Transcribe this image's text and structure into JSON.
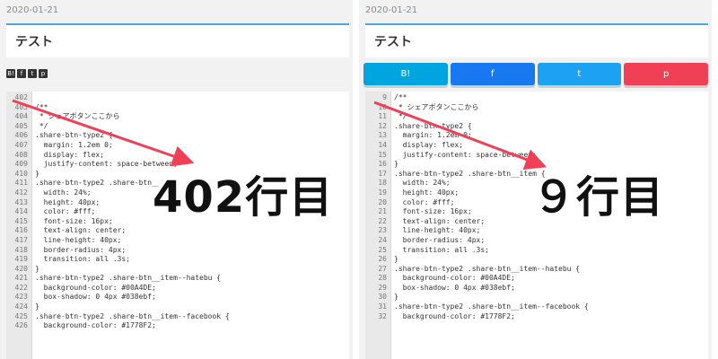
{
  "left": {
    "date": "2020-01-21",
    "title": "テスト",
    "icons": [
      "B!",
      "f",
      "t",
      "p"
    ],
    "lines": [
      {
        "n": "402",
        "t": ""
      },
      {
        "n": "403",
        "t": "/**"
      },
      {
        "n": "404",
        "t": " * シェアボタンここから"
      },
      {
        "n": "405",
        "t": " */"
      },
      {
        "n": "406",
        "t": ".share-btn-type2 {"
      },
      {
        "n": "407",
        "t": "  margin: 1.2em 0;"
      },
      {
        "n": "408",
        "t": "  display: flex;"
      },
      {
        "n": "409",
        "t": "  justify-content: space-between;"
      },
      {
        "n": "410",
        "t": "}"
      },
      {
        "n": "411",
        "t": ".share-btn-type2 .share-btn__"
      },
      {
        "n": "412",
        "t": "  width: 24%;"
      },
      {
        "n": "413",
        "t": "  height: 40px;"
      },
      {
        "n": "414",
        "t": "  color: #fff;"
      },
      {
        "n": "415",
        "t": "  font-size: 16px;"
      },
      {
        "n": "416",
        "t": "  text-align: center;"
      },
      {
        "n": "417",
        "t": "  line-height: 40px;"
      },
      {
        "n": "418",
        "t": "  border-radius: 4px;"
      },
      {
        "n": "419",
        "t": "  transition: all .3s;"
      },
      {
        "n": "420",
        "t": "}"
      },
      {
        "n": "421",
        "t": ".share-btn-type2 .share-btn__item--hatebu {"
      },
      {
        "n": "422",
        "t": "  background-color: #00A4DE;"
      },
      {
        "n": "423",
        "t": "  box-shadow: 0 4px #038ebf;"
      },
      {
        "n": "424",
        "t": "}"
      },
      {
        "n": "425",
        "t": ".share-btn-type2 .share-btn__item--facebook {"
      },
      {
        "n": "426",
        "t": "  background-color: #1778F2;"
      }
    ],
    "overlay": "402行目"
  },
  "right": {
    "date": "2020-01-21",
    "title": "テスト",
    "buttons": [
      {
        "label": "B!",
        "color": "#00A4DE"
      },
      {
        "label": "f",
        "color": "#1778F2"
      },
      {
        "label": "t",
        "color": "#1DA1F2"
      },
      {
        "label": "p",
        "color": "#EF4056"
      }
    ],
    "lines": [
      {
        "n": "9",
        "t": "/**"
      },
      {
        "n": "10",
        "t": " * シェアボタンここから"
      },
      {
        "n": "11",
        "t": " */"
      },
      {
        "n": "12",
        "t": ".share-btn-type2 {"
      },
      {
        "n": "13",
        "t": "  margin: 1.2em 0;"
      },
      {
        "n": "14",
        "t": "  display: flex;"
      },
      {
        "n": "15",
        "t": "  justify-content: space-between;"
      },
      {
        "n": "16",
        "t": "}"
      },
      {
        "n": "17",
        "t": ".share-btn-type2 .share-btn__item {"
      },
      {
        "n": "18",
        "t": "  width: 24%;"
      },
      {
        "n": "19",
        "t": "  height: 40px;"
      },
      {
        "n": "20",
        "t": "  color: #fff;"
      },
      {
        "n": "21",
        "t": "  font-size: 16px;"
      },
      {
        "n": "22",
        "t": "  text-align: center;"
      },
      {
        "n": "23",
        "t": "  line-height: 40px;"
      },
      {
        "n": "24",
        "t": "  border-radius: 4px;"
      },
      {
        "n": "25",
        "t": "  transition: all .3s;"
      },
      {
        "n": "26",
        "t": "}"
      },
      {
        "n": "27",
        "t": ".share-btn-type2 .share-btn__item--hatebu {"
      },
      {
        "n": "28",
        "t": "  background-color: #00A4DE;"
      },
      {
        "n": "29",
        "t": "  box-shadow: 0 4px #038ebf;"
      },
      {
        "n": "30",
        "t": "}"
      },
      {
        "n": "31",
        "t": ".share-btn-type2 .share-btn__item--facebook {"
      },
      {
        "n": "32",
        "t": "  background-color: #1778F2;"
      }
    ],
    "overlay": "９行目"
  },
  "arrow_color": "#EF4056"
}
